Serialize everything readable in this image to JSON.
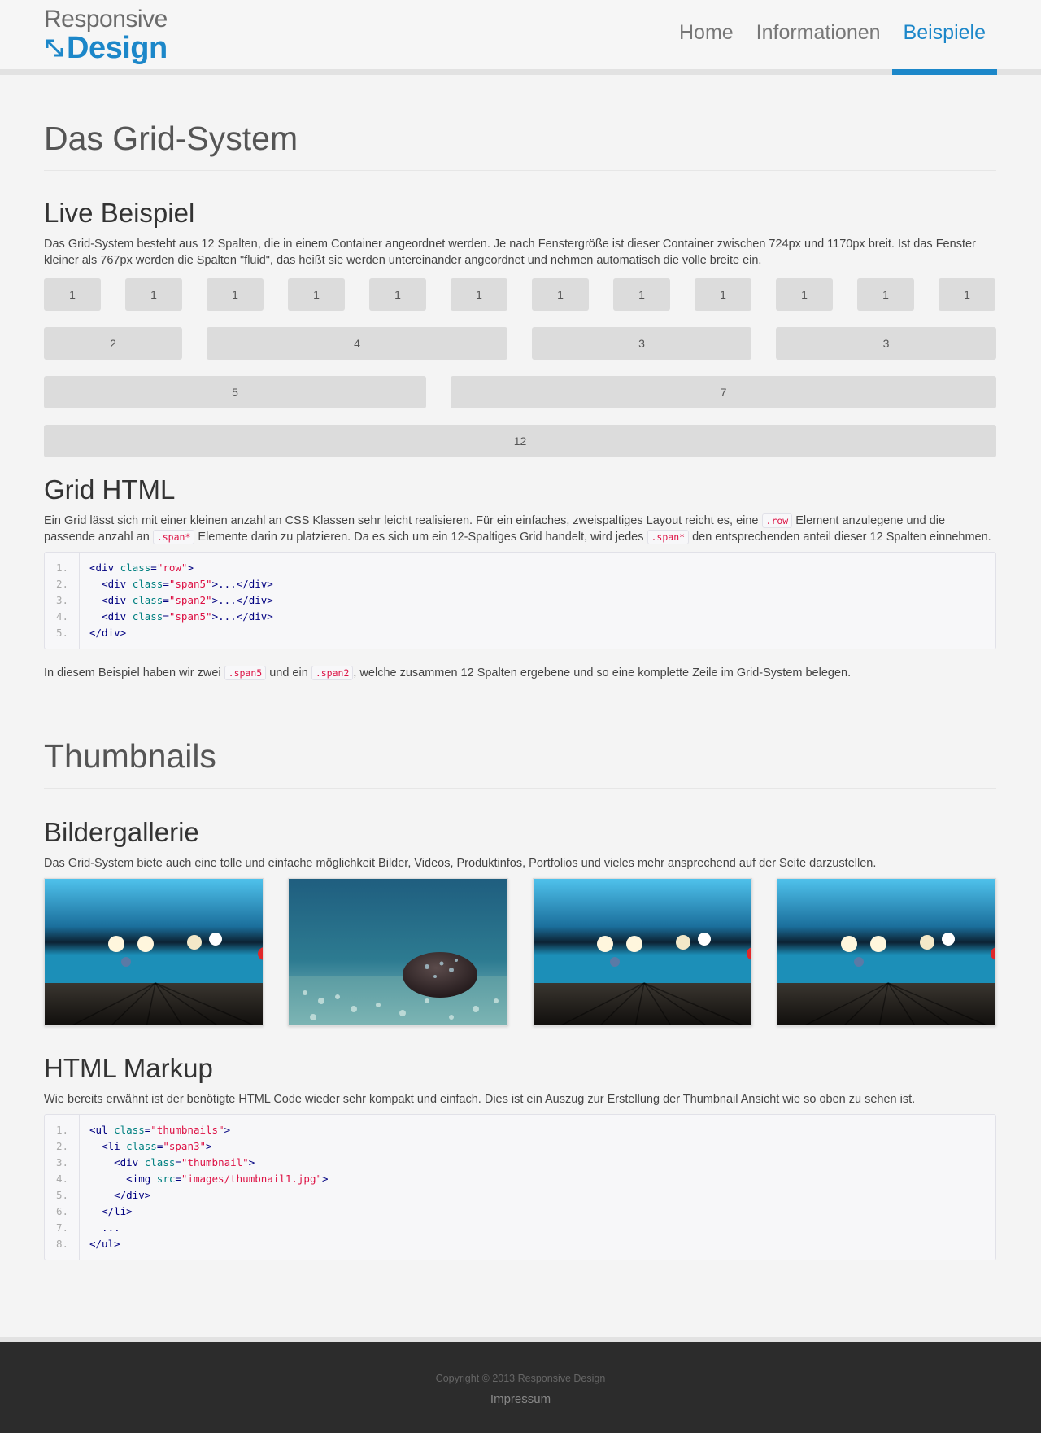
{
  "logo": {
    "line1": "Responsive",
    "line2": "Design",
    "arrow_icon": "diagonal-resize-arrow"
  },
  "nav": {
    "items": [
      {
        "label": "Home"
      },
      {
        "label": "Informationen"
      },
      {
        "label": "Beispiele"
      }
    ],
    "active_color": "#1c87c9"
  },
  "grid_section": {
    "title": "Das Grid-System",
    "live": {
      "heading": "Live Beispiel",
      "text": "Das Grid-System besteht aus 12 Spalten, die in einem Container angeordnet werden. Je nach Fenstergröße ist dieser Container zwischen 724px und 1170px breit. Ist das Fenster kleiner als 767px werden die Spalten \"fluid\", das heißt sie werden untereinander angeordnet und nehmen automatisch die volle breite ein.",
      "rows": [
        [
          "1",
          "1",
          "1",
          "1",
          "1",
          "1",
          "1",
          "1",
          "1",
          "1",
          "1",
          "1"
        ],
        [
          "2",
          "4",
          "3",
          "3"
        ],
        [
          "5",
          "7"
        ],
        [
          "12"
        ]
      ]
    },
    "html": {
      "heading": "Grid HTML",
      "text_a": "Ein Grid lässt sich mit einer kleinen anzahl an CSS Klassen sehr leicht realisieren. Für ein einfaches, zweispaltiges Layout reicht es, eine ",
      "code_row": ".row",
      "text_b": " Element anzulegene und die passende anzahl an ",
      "code_span": ".span*",
      "text_c": " Elemente darin zu platzieren. Da es sich um ein 12-Spaltiges Grid handelt, wird jedes ",
      "code_span2": ".span*",
      "text_d": " den entsprechenden anteil dieser 12 Spalten einnehmen.",
      "line_numbers": [
        "1.",
        "2.",
        "3.",
        "4.",
        "5."
      ],
      "after_a": "In diesem Beispiel haben wir zwei ",
      "after_code1": ".span5",
      "after_b": " und ein ",
      "after_code2": ".span2",
      "after_c": ", welche zusammen 12 Spalten ergebene und so eine komplette Zeile im Grid-System belegen."
    }
  },
  "thumb_section": {
    "title": "Thumbnails",
    "gallery": {
      "heading": "Bildergallerie",
      "text": "Das Grid-System biete auch eine tolle und einfache möglichkeit Bilder, Videos, Produktinfos, Portfolios und vieles mehr ansprechend auf der Seite darzustellen."
    },
    "markup": {
      "heading": "HTML Markup",
      "text": "Wie bereits erwähnt ist der benötigte HTML Code wieder sehr kompakt und einfach. Dies ist ein Auszug zur Erstellung der Thumbnail Ansicht wie so oben zu sehen ist.",
      "line_numbers": [
        "1.",
        "2.",
        "3.",
        "4.",
        "5.",
        "6.",
        "7.",
        "8."
      ]
    }
  },
  "footer": {
    "copyright": "Copyright © 2013 Responsive Design",
    "imprint": "Impressum"
  }
}
